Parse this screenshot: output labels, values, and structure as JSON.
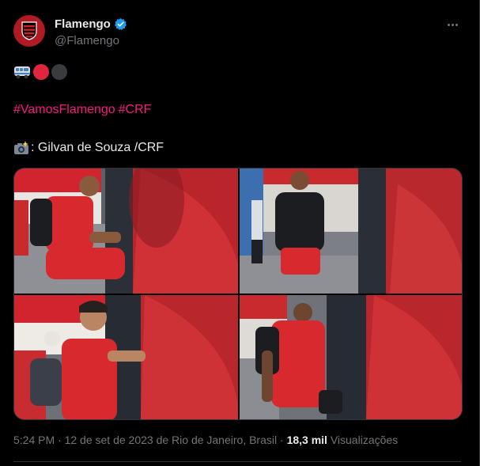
{
  "author": {
    "display_name": "Flamengo",
    "handle": "@Flamengo",
    "verified_icon": "verified-badge-icon",
    "avatar_icon": "flamengo-crest-icon"
  },
  "tweet": {
    "emoji_line": [
      {
        "icon": "bus-icon"
      },
      {
        "icon": "red-circle-icon",
        "color": "#e0263d"
      },
      {
        "icon": "black-circle-icon",
        "color": "#3a3b3e"
      }
    ],
    "hashtags": [
      "#VamosFlamengo",
      "#CRF"
    ],
    "credit_icon": "camera-flash-icon",
    "credit_text": ": Gilvan de Souza /CRF"
  },
  "media": [
    {
      "name": "photo-player-sitting-by-bus"
    },
    {
      "name": "photo-player-black-jacket-walking"
    },
    {
      "name": "photo-player-smiling-boarding"
    },
    {
      "name": "photo-player-backpack-entering-bus"
    }
  ],
  "meta": {
    "time": "5:24 PM",
    "separator": " · ",
    "date_location": "12 de set de 2023 de Rio de Janeiro, Brasil",
    "views_count": "18,3 mil",
    "views_label": " Visualizações"
  },
  "colors": {
    "background": "#000000",
    "text": "#e7e9ea",
    "muted": "#71767b",
    "hashtag": "#f91880",
    "verified": "#1d9bf0",
    "brand_red": "#b01a23"
  }
}
